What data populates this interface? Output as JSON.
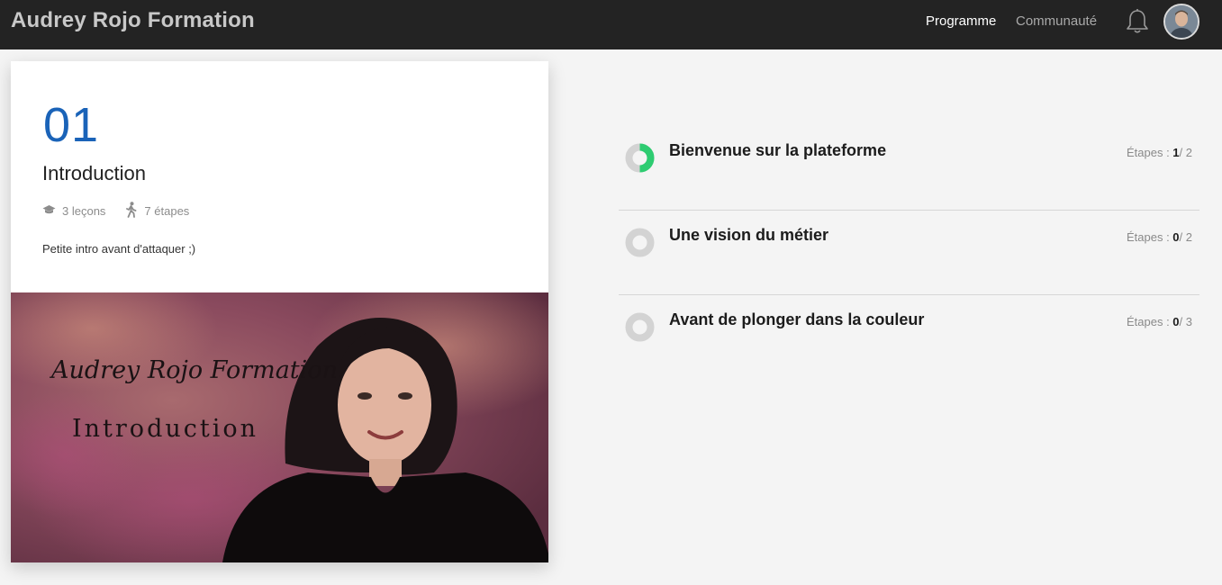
{
  "header": {
    "brand": "Audrey Rojo Formation",
    "nav": [
      {
        "label": "Programme",
        "active": true
      },
      {
        "label": "Communauté",
        "active": false
      }
    ],
    "bell_icon": "bell-icon",
    "avatar_icon": "user-avatar"
  },
  "module": {
    "number": "01",
    "title": "Introduction",
    "lessons_label": "3 leçons",
    "steps_label": "7 étapes",
    "description": "Petite intro avant d'attaquer ;)",
    "media": {
      "script_title": "Audrey Rojo Formation",
      "caption": "Introduction"
    }
  },
  "lessons": [
    {
      "title": "Bienvenue sur la plateforme",
      "steps_prefix": "Étapes : ",
      "done": "1",
      "total": "/ 2",
      "progress": 0.5
    },
    {
      "title": "Une vision du métier",
      "steps_prefix": "Étapes : ",
      "done": "0",
      "total": "/ 2",
      "progress": 0
    },
    {
      "title": "Avant de plonger dans la couleur",
      "steps_prefix": "Étapes : ",
      "done": "0",
      "total": "/ 3",
      "progress": 0
    }
  ],
  "colors": {
    "accent": "#1a63b8",
    "progress": "#2ecc71",
    "ring_track": "#d3d3d3",
    "topbar": "#232323"
  }
}
